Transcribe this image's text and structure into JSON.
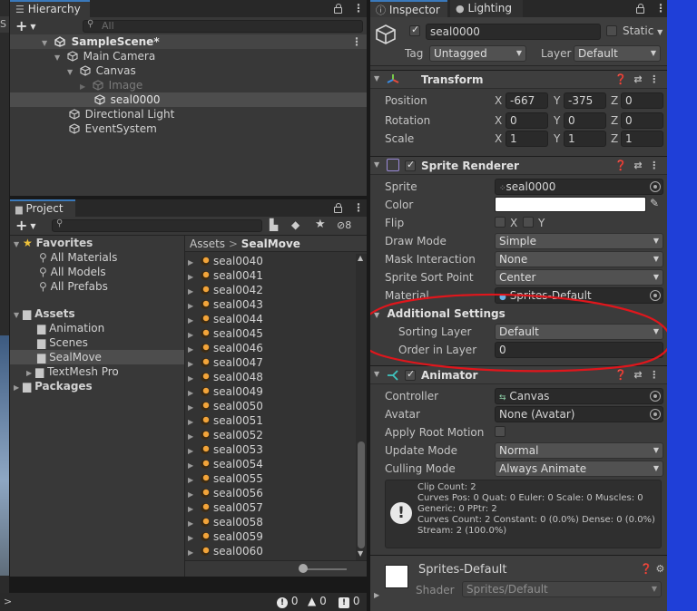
{
  "hierarchy": {
    "tab_label": "Hierarchy",
    "search_placeholder": "All",
    "items": [
      {
        "label": "SampleScene*",
        "icon": "unity-scene-icon"
      },
      {
        "label": "Main Camera",
        "icon": "cube-icon"
      },
      {
        "label": "Canvas",
        "icon": "cube-icon"
      },
      {
        "label": "Image",
        "icon": "cube-icon"
      },
      {
        "label": "seal0000",
        "icon": "cube-icon"
      },
      {
        "label": "Directional Light",
        "icon": "cube-icon"
      },
      {
        "label": "EventSystem",
        "icon": "cube-icon"
      }
    ]
  },
  "project": {
    "tab_label": "Project",
    "hidden_count": "8",
    "tree": [
      {
        "label": "Favorites",
        "kind": "header"
      },
      {
        "label": "All Materials",
        "kind": "search"
      },
      {
        "label": "All Models",
        "kind": "search"
      },
      {
        "label": "All Prefabs",
        "kind": "search"
      },
      {
        "label": "Assets",
        "kind": "header-folder"
      },
      {
        "label": "Animation",
        "kind": "folder"
      },
      {
        "label": "Scenes",
        "kind": "folder"
      },
      {
        "label": "SealMove",
        "kind": "folder"
      },
      {
        "label": "TextMesh Pro",
        "kind": "folder"
      },
      {
        "label": "Packages",
        "kind": "header-folder"
      }
    ],
    "breadcrumb": {
      "root": "Assets",
      "sep": ">",
      "current": "SealMove"
    },
    "files": [
      "seal0040",
      "seal0041",
      "seal0042",
      "seal0043",
      "seal0044",
      "seal0045",
      "seal0046",
      "seal0047",
      "seal0048",
      "seal0049",
      "seal0050",
      "seal0051",
      "seal0052",
      "seal0053",
      "seal0054",
      "seal0055",
      "seal0056",
      "seal0057",
      "seal0058",
      "seal0059",
      "seal0060"
    ]
  },
  "status": {
    "errors": "0",
    "warnings": "0",
    "infos": "0"
  },
  "inspector": {
    "tabs": {
      "inspector": "Inspector",
      "lighting": "Lighting"
    },
    "object_name": "seal0000",
    "static_label": "Static",
    "tag_label": "Tag",
    "tag_value": "Untagged",
    "layer_label": "Layer",
    "layer_value": "Default",
    "transform": {
      "title": "Transform",
      "position": {
        "label": "Position",
        "x": "-667",
        "y": "-375",
        "z": "0"
      },
      "rotation": {
        "label": "Rotation",
        "x": "0",
        "y": "0",
        "z": "0"
      },
      "scale": {
        "label": "Scale",
        "x": "1",
        "y": "1",
        "z": "1"
      },
      "axis_x": "X",
      "axis_y": "Y",
      "axis_z": "Z"
    },
    "sprite_renderer": {
      "title": "Sprite Renderer",
      "sprite_label": "Sprite",
      "sprite_value": "seal0000",
      "color_label": "Color",
      "flip_label": "Flip",
      "flip_x": "X",
      "flip_y": "Y",
      "draw_mode_label": "Draw Mode",
      "draw_mode_value": "Simple",
      "mask_label": "Mask Interaction",
      "mask_value": "None",
      "sort_point_label": "Sprite Sort Point",
      "sort_point_value": "Center",
      "material_label": "Material",
      "material_value": "Sprites-Default",
      "additional_label": "Additional Settings",
      "sorting_layer_label": "Sorting Layer",
      "sorting_layer_value": "Default",
      "order_label": "Order in Layer",
      "order_value": "0"
    },
    "animator": {
      "title": "Animator",
      "controller_label": "Controller",
      "controller_value": "Canvas",
      "avatar_label": "Avatar",
      "avatar_value": "None (Avatar)",
      "root_motion_label": "Apply Root Motion",
      "update_label": "Update Mode",
      "update_value": "Normal",
      "culling_label": "Culling Mode",
      "culling_value": "Always Animate",
      "info_lines": [
        "Clip Count: 2",
        "Curves Pos: 0 Quat: 0 Euler: 0 Scale: 0 Muscles: 0",
        "Generic: 0 PPtr: 2",
        "Curves Count: 2 Constant: 0 (0.0%) Dense: 0 (0.0%)",
        "Stream: 2 (100.0%)"
      ]
    },
    "material": {
      "name": "Sprites-Default",
      "shader_label": "Shader",
      "shader_value": "Sprites/Default"
    }
  },
  "colors": {
    "annotation": "#e0161c",
    "accent": "#3a79bb",
    "scene_blue": "#1f3fd8"
  }
}
